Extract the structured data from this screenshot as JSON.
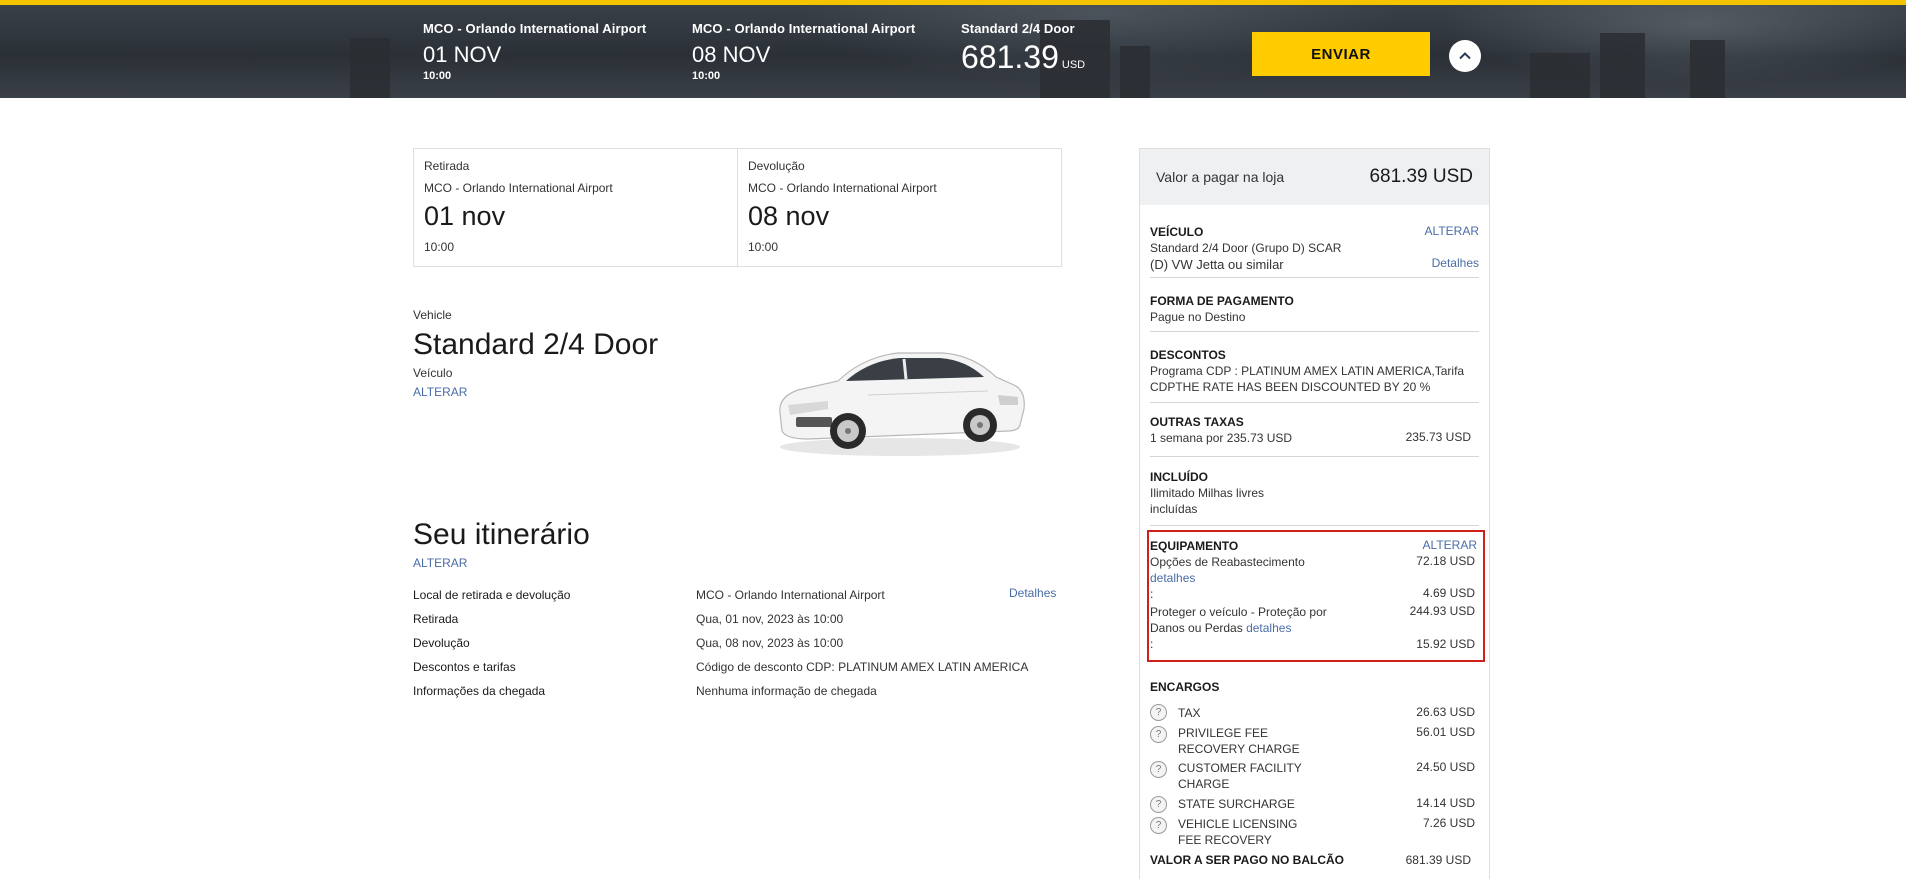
{
  "topbar": {
    "pickup_location": "MCO - Orlando International Airport",
    "pickup_date": "01 NOV",
    "pickup_time": "10:00",
    "return_location": "MCO - Orlando International Airport",
    "return_date": "08 NOV",
    "return_time": "10:00",
    "vehicle_name": "Standard 2/4 Door",
    "price": "681.39",
    "currency": "USD",
    "send_label": "ENVIAR",
    "collapse_icon": "chevron-up-icon"
  },
  "locations": {
    "pickup": {
      "label": "Retirada",
      "location": "MCO - Orlando International Airport",
      "date": "01 nov",
      "time": "10:00"
    },
    "return": {
      "label": "Devolução",
      "location": "MCO - Orlando International Airport",
      "date": "08 nov",
      "time": "10:00"
    }
  },
  "vehicle": {
    "eyebrow": "Vehicle",
    "title": "Standard 2/4 Door",
    "subtitle": "Veículo",
    "change_label": "ALTERAR"
  },
  "itinerary": {
    "title": "Seu itinerário",
    "change_label": "ALTERAR",
    "details_label": "Detalhes",
    "rows": [
      {
        "key": "Local de retirada e devolução",
        "value": "MCO - Orlando International Airport"
      },
      {
        "key": "Retirada",
        "value": "Qua, 01 nov, 2023 às 10:00"
      },
      {
        "key": "Devolução",
        "value": "Qua, 08 nov, 2023 às 10:00"
      },
      {
        "key": "Descontos e tarifas",
        "value": "Código de desconto CDP: PLATINUM AMEX LATIN AMERICA"
      },
      {
        "key": "Informações da chegada",
        "value": "Nenhuma informação de chegada"
      }
    ]
  },
  "summary": {
    "header_label": "Valor a pagar na loja",
    "header_value": "681.39 USD",
    "vehicle": {
      "heading": "VEÍCULO",
      "change": "ALTERAR",
      "line1": "Standard 2/4 Door (Grupo D) SCAR",
      "line2": "(D) VW Jetta ou similar",
      "details": "Detalhes"
    },
    "payment": {
      "heading": "FORMA DE PAGAMENTO",
      "line": "Pague no Destino"
    },
    "discounts": {
      "heading": "DESCONTOS",
      "line1": "Programa CDP : PLATINUM AMEX LATIN AMERICA,Tarifa",
      "line2": "CDPTHE RATE HAS BEEN DISCOUNTED BY 20 %"
    },
    "other_fees": {
      "heading": "OUTRAS TAXAS",
      "line": "1 semana por 235.73 USD",
      "amount": "235.73 USD"
    },
    "included": {
      "heading": "INCLUÍDO",
      "line1": "Ilimitado Milhas livres",
      "line2": "incluídas"
    },
    "equipment": {
      "heading": "EQUIPAMENTO",
      "change": "ALTERAR",
      "refuel_label": "Opções de Reabastecimento",
      "refuel_amount": "72.18 USD",
      "refuel_details": "detalhes",
      "refuel_colon": ":",
      "refuel_extra_amount": "4.69 USD",
      "protect_line1": "Proteger o veículo - Proteção por",
      "protect_line2": "Danos ou Perdas",
      "protect_details": "detalhes",
      "protect_amount": "244.93 USD",
      "protect_colon": ":",
      "protect_extra_amount": "15.92 USD"
    },
    "charges": {
      "heading": "ENCARGOS",
      "items": [
        {
          "line1": "TAX",
          "line2": "",
          "amount": "26.63 USD"
        },
        {
          "line1": "PRIVILEGE FEE",
          "line2": "RECOVERY CHARGE",
          "amount": "56.01 USD"
        },
        {
          "line1": "CUSTOMER FACILITY",
          "line2": "CHARGE",
          "amount": "24.50 USD"
        },
        {
          "line1": "STATE SURCHARGE",
          "line2": "",
          "amount": "14.14 USD"
        },
        {
          "line1": "VEHICLE LICENSING",
          "line2": "FEE RECOVERY",
          "amount": "7.26 USD"
        }
      ],
      "help_glyph": "?",
      "total_label": "VALOR A SER PAGO NO BALCÃO",
      "total_amount": "681.39 USD"
    }
  }
}
